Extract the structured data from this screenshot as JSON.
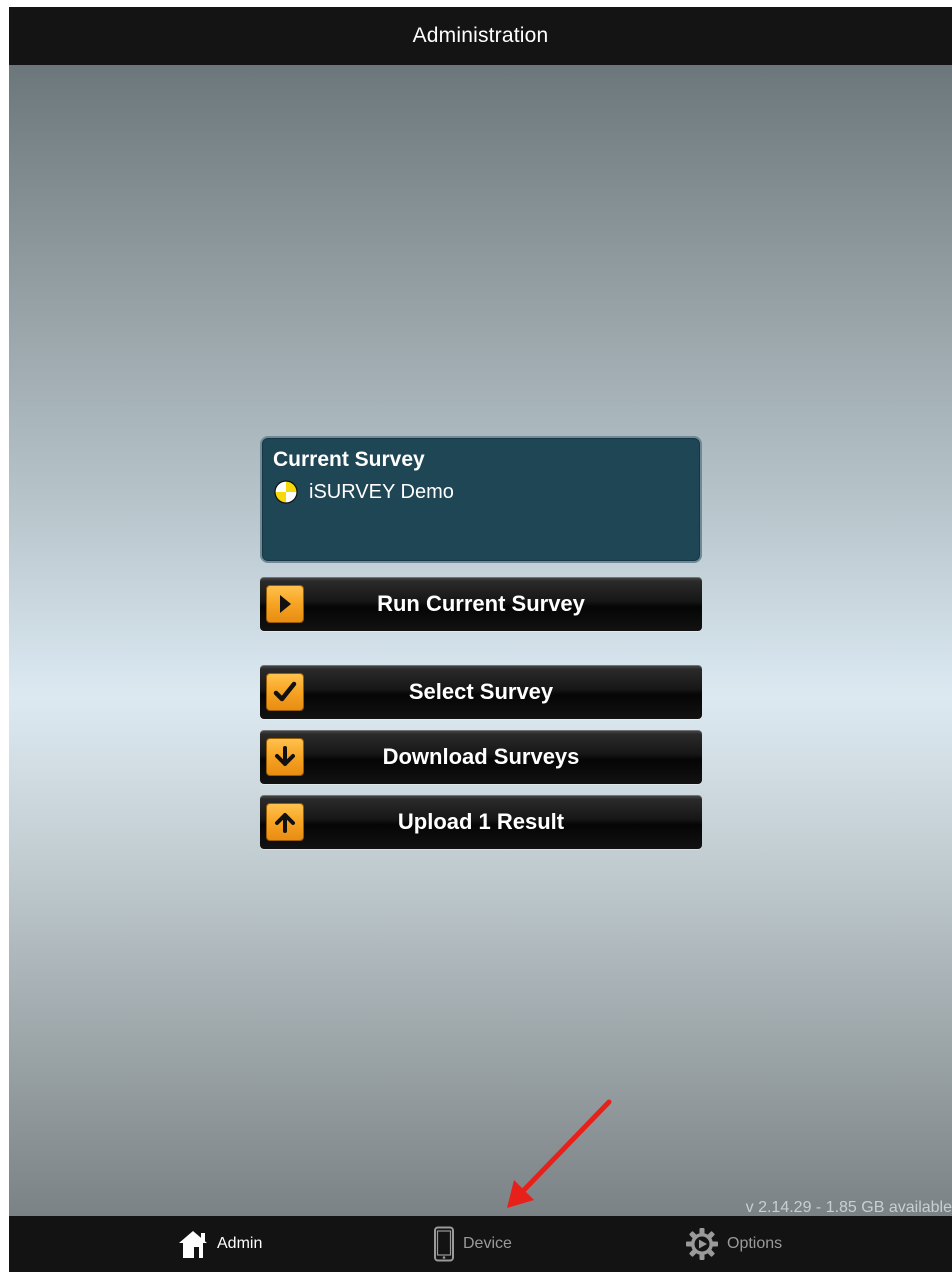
{
  "header": {
    "title": "Administration"
  },
  "current_survey": {
    "heading": "Current Survey",
    "name": "iSURVEY Demo",
    "icon": "survey-target-icon"
  },
  "buttons": [
    {
      "label": "Run Current Survey",
      "icon": "play-icon"
    },
    {
      "label": "Select Survey",
      "icon": "checkmark-icon"
    },
    {
      "label": "Download Surveys",
      "icon": "down-arrow-icon"
    },
    {
      "label": "Upload 1 Result",
      "icon": "up-arrow-icon"
    }
  ],
  "footer": {
    "version": "v 2.14.29 - 1.85 GB available"
  },
  "tabbar": {
    "tabs": [
      {
        "label": "Admin",
        "icon": "home-icon",
        "selected": true
      },
      {
        "label": "Device",
        "icon": "tablet-icon",
        "selected": false
      },
      {
        "label": "Options",
        "icon": "gear-icon",
        "selected": false
      }
    ]
  },
  "colors": {
    "accent": "#f6a323",
    "card_background": "#1f4655",
    "bar_background": "#141414",
    "annotation_arrow": "#e8201a"
  }
}
